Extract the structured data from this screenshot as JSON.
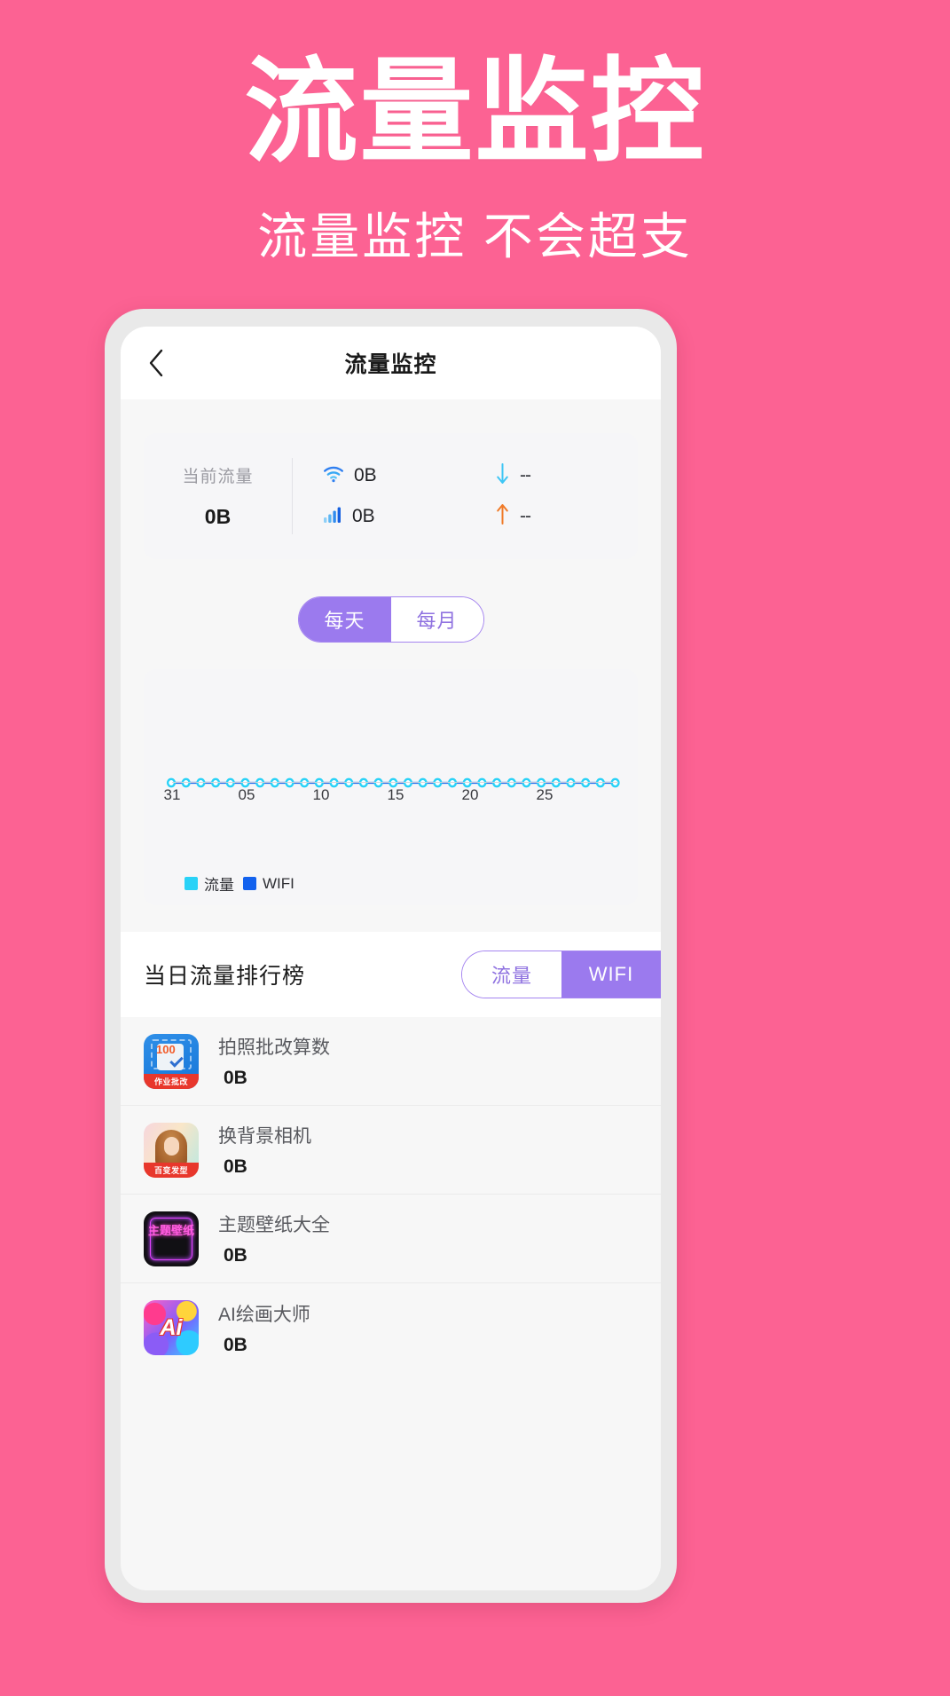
{
  "promo": {
    "title": "流量监控",
    "subtitle": "流量监控 不会超支",
    "background_color": "#fc6293"
  },
  "app": {
    "header": {
      "back_icon": "chevron-left-icon",
      "title": "流量监控"
    },
    "stats": {
      "current_label": "当前流量",
      "current_value": "0B",
      "wifi_icon": "wifi-icon",
      "wifi_value": "0B",
      "cellular_icon": "signal-bars-icon",
      "cellular_value": "0B",
      "download_icon": "arrow-down-icon",
      "download_value": "--",
      "upload_icon": "arrow-up-icon",
      "upload_value": "--",
      "download_color": "#3fc6f5",
      "upload_color": "#f07a28"
    },
    "period_toggle": {
      "options": [
        "每天",
        "每月"
      ],
      "selected": "每天",
      "accent_color": "#9b7aee"
    },
    "ranking": {
      "title": "当日流量排行榜",
      "type_toggle": {
        "options": [
          "流量",
          "WIFI"
        ],
        "selected": "WIFI"
      },
      "items": [
        {
          "name": "拍照批改算数",
          "size": "0B",
          "icon": "app-icon-homework",
          "icon_badge": "作业批改",
          "icon_text": "100"
        },
        {
          "name": "换背景相机",
          "size": "0B",
          "icon": "app-icon-camera",
          "icon_badge": "百变发型",
          "icon_text": ""
        },
        {
          "name": "主题壁纸大全",
          "size": "0B",
          "icon": "app-icon-wallpaper",
          "icon_badge": "",
          "icon_text": "主题壁纸"
        },
        {
          "name": "AI绘画大师",
          "size": "0B",
          "icon": "app-icon-ai",
          "icon_badge": "",
          "icon_text": "Ai"
        }
      ]
    }
  },
  "chart_data": {
    "type": "line",
    "title": "",
    "xlabel": "",
    "ylabel": "",
    "tick_labels": [
      "31",
      "05",
      "10",
      "15",
      "20",
      "25"
    ],
    "tick_positions": [
      0,
      16.7,
      33.4,
      50.1,
      66.8,
      83.5
    ],
    "x": [
      31,
      1,
      2,
      3,
      4,
      5,
      6,
      7,
      8,
      9,
      10,
      11,
      12,
      13,
      14,
      15,
      16,
      17,
      18,
      19,
      20,
      21,
      22,
      23,
      24,
      25,
      26,
      27,
      28,
      29,
      30
    ],
    "series": [
      {
        "name": "流量",
        "color": "#29d2f7",
        "values": [
          0,
          0,
          0,
          0,
          0,
          0,
          0,
          0,
          0,
          0,
          0,
          0,
          0,
          0,
          0,
          0,
          0,
          0,
          0,
          0,
          0,
          0,
          0,
          0,
          0,
          0,
          0,
          0,
          0,
          0,
          0
        ]
      },
      {
        "name": "WIFI",
        "color": "#1362ee",
        "values": [
          0,
          0,
          0,
          0,
          0,
          0,
          0,
          0,
          0,
          0,
          0,
          0,
          0,
          0,
          0,
          0,
          0,
          0,
          0,
          0,
          0,
          0,
          0,
          0,
          0,
          0,
          0,
          0,
          0,
          0,
          0
        ]
      }
    ],
    "legend": [
      {
        "label": "流量",
        "color": "#29d2f7"
      },
      {
        "label": "WIFI",
        "color": "#1362ee"
      }
    ],
    "legend_position": "bottom-left",
    "ylim": [
      0,
      1
    ],
    "grid": false
  }
}
